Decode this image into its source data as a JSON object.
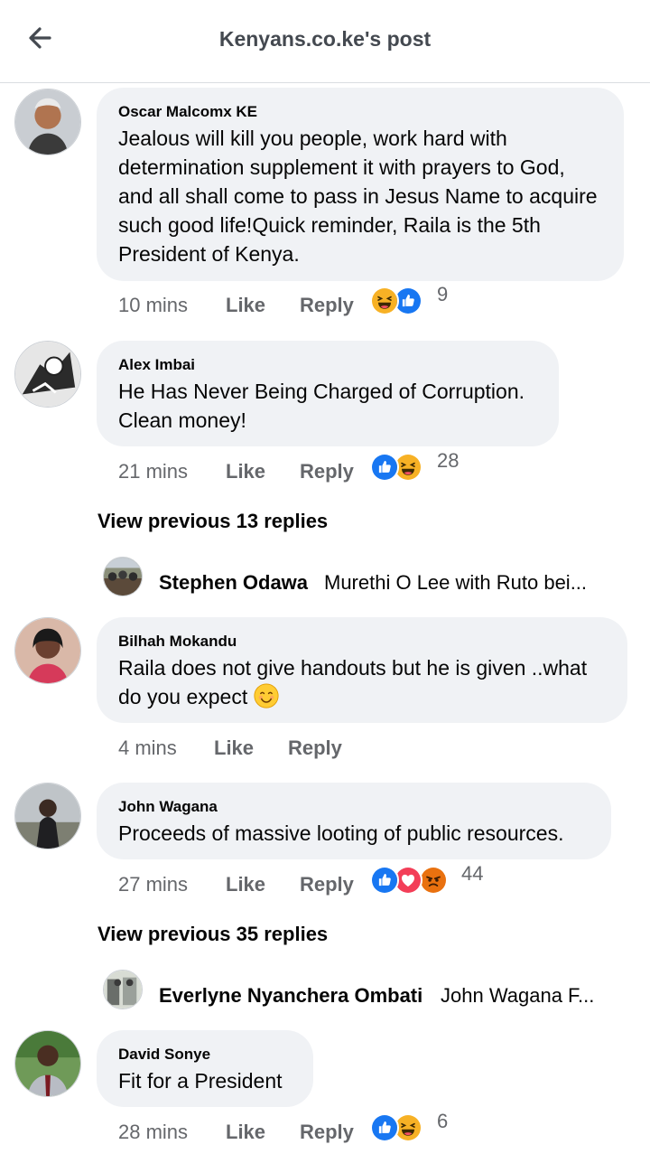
{
  "header": {
    "title": "Kenyans.co.ke's post",
    "back_icon": "arrow-left-icon"
  },
  "comments": [
    {
      "author": "Oscar Malcomx KE",
      "text": "Jealous will kill you people, work hard with determination supplement it with prayers to God, and all shall come to pass in Jesus Name to acquire such good life!Quick reminder, Raila is the 5th President of Kenya.",
      "time": "10 mins",
      "like": "Like",
      "reply": "Reply",
      "reactions": [
        "haha",
        "like"
      ],
      "reaction_count": "9"
    },
    {
      "author": "Alex Imbai",
      "text": "He Has Never Being Charged of Corruption. Clean money!",
      "time": "21 mins",
      "like": "Like",
      "reply": "Reply",
      "reactions": [
        "like",
        "haha"
      ],
      "reaction_count": "28",
      "view_previous": "View previous 13 replies",
      "latest_reply": {
        "author": "Stephen Odawa",
        "text": "Murethi O Lee with Ruto bei..."
      }
    },
    {
      "author": "Bilhah Mokandu",
      "text": "Raila does not give handouts but he is given ..what do you expect",
      "emoji": "smiling-face-icon",
      "time": "4 mins",
      "like": "Like",
      "reply": "Reply"
    },
    {
      "author": "John Wagana",
      "text": "Proceeds of massive looting of public resources.",
      "time": "27 mins",
      "like": "Like",
      "reply": "Reply",
      "reactions": [
        "like",
        "love",
        "angry"
      ],
      "reaction_count": "44",
      "view_previous": "View previous 35 replies",
      "latest_reply": {
        "author": "Everlyne Nyanchera Ombati",
        "text": "John Wagana F..."
      }
    },
    {
      "author": "David Sonye",
      "text": "Fit for a President",
      "time": "28 mins",
      "like": "Like",
      "reply": "Reply",
      "reactions": [
        "like",
        "haha"
      ],
      "reaction_count": "6"
    }
  ],
  "colors": {
    "like_blue": "#1877f2",
    "love_red": "#f33e58",
    "haha_yellow": "#f7b125",
    "angry_orange": "#e9710f",
    "bubble_bg": "#f0f2f5",
    "meta_gray": "#65676b"
  }
}
